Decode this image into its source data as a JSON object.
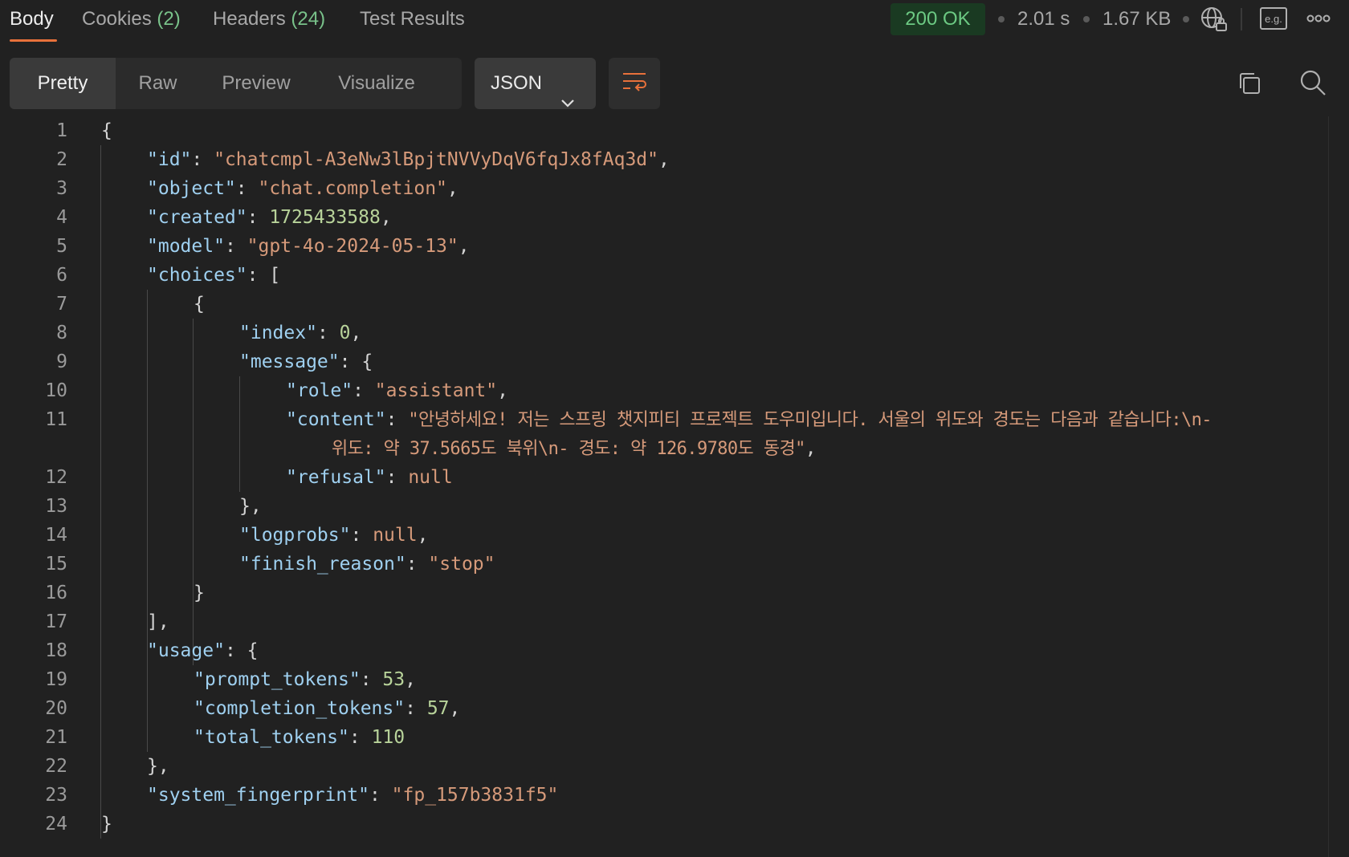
{
  "response_tabs": [
    {
      "label": "Body",
      "count": ""
    },
    {
      "label": "Cookies",
      "count": "(2)"
    },
    {
      "label": "Headers",
      "count": "(24)"
    },
    {
      "label": "Test Results",
      "count": ""
    }
  ],
  "status": {
    "code_text": "200 OK",
    "time": "2.01 s",
    "size": "1.67 KB",
    "example_label": "e.g."
  },
  "view_modes": [
    "Pretty",
    "Raw",
    "Preview",
    "Visualize"
  ],
  "format_select": {
    "value": "JSON"
  },
  "icons": {
    "network": "globe-lock-icon",
    "examples": "example-icon",
    "more": "more-icon",
    "wrap": "wrap-lines-icon",
    "copy": "copy-icon",
    "search": "search-icon",
    "chevron": "chevron-down-icon"
  },
  "colors": {
    "accent": "#e8713b",
    "status_ok": "#6cc983",
    "json_key": "#9fd0f0",
    "json_string": "#d69a7a",
    "json_number": "#b8d39a"
  },
  "code": {
    "line_numbers": [
      "1",
      "2",
      "3",
      "4",
      "5",
      "6",
      "7",
      "8",
      "9",
      "10",
      "11",
      "12",
      "13",
      "14",
      "15",
      "16",
      "17",
      "18",
      "19",
      "20",
      "21",
      "22",
      "23",
      "24"
    ],
    "l1": "{",
    "l2": {
      "key": "\"id\"",
      "value": "\"chatcmpl-A3eNw3lBpjtNVVyDqV6fqJx8fAq3d\""
    },
    "l3": {
      "key": "\"object\"",
      "value": "\"chat.completion\""
    },
    "l4": {
      "key": "\"created\"",
      "value": "1725433588"
    },
    "l5": {
      "key": "\"model\"",
      "value": "\"gpt-4o-2024-05-13\""
    },
    "l6": {
      "key": "\"choices\"",
      "value": "["
    },
    "l7": "{",
    "l8": {
      "key": "\"index\"",
      "value": "0"
    },
    "l9": {
      "key": "\"message\"",
      "value": "{"
    },
    "l10": {
      "key": "\"role\"",
      "value": "\"assistant\""
    },
    "l11": {
      "key": "\"content\"",
      "value": "\"안녕하세요! 저는 스프링 챗지피티 프로젝트 도우미입니다. 서울의 위도와 경도는 다음과 같습니다:\\n-",
      "value_cont": "위도: 약 37.5665도 북위\\n- 경도: 약 126.9780도 동경\""
    },
    "l12": {
      "key": "\"refusal\"",
      "value": "null"
    },
    "l13": "},",
    "l14": {
      "key": "\"logprobs\"",
      "value": "null"
    },
    "l15": {
      "key": "\"finish_reason\"",
      "value": "\"stop\""
    },
    "l16": "}",
    "l17": "],",
    "l18": {
      "key": "\"usage\"",
      "value": "{"
    },
    "l19": {
      "key": "\"prompt_tokens\"",
      "value": "53"
    },
    "l20": {
      "key": "\"completion_tokens\"",
      "value": "57"
    },
    "l21": {
      "key": "\"total_tokens\"",
      "value": "110"
    },
    "l22": "},",
    "l23": {
      "key": "\"system_fingerprint\"",
      "value": "\"fp_157b3831f5\""
    },
    "l24": "}"
  }
}
